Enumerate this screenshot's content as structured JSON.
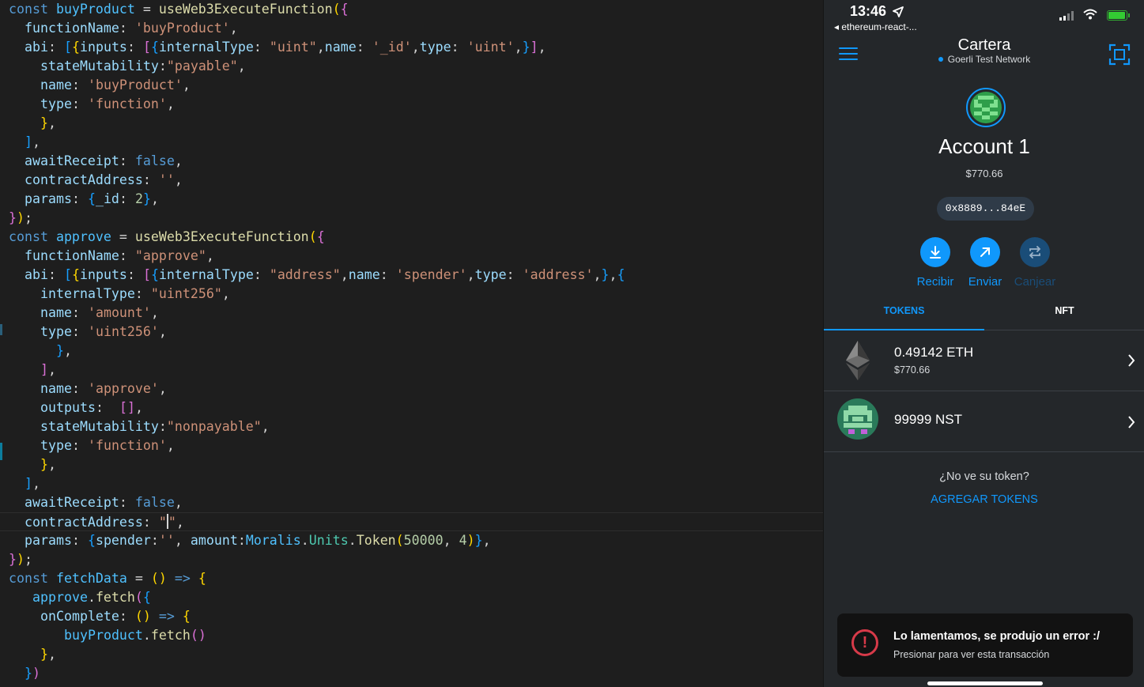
{
  "editor": {
    "lines": [
      "const buyProduct = useWeb3ExecuteFunction({",
      "  functionName: 'buyProduct',",
      "  abi: [{inputs: [{internalType: \"uint\",name: '_id',type: 'uint',}],",
      "    stateMutability:\"payable\",",
      "    name: 'buyProduct',",
      "    type: 'function',",
      "    },",
      "  ],",
      "  awaitReceipt: false,",
      "  contractAddress: '',",
      "  params: {_id: 2},",
      "});",
      "const approve = useWeb3ExecuteFunction({",
      "  functionName: \"approve\",",
      "  abi: [{inputs: [{internalType: \"address\",name: 'spender',type: 'address',},{",
      "    internalType: \"uint256\",",
      "    name: 'amount',",
      "    type: 'uint256',",
      "      },",
      "    ],",
      "    name: 'approve',",
      "    outputs:  [],",
      "    stateMutability:\"nonpayable\",",
      "    type: 'function',",
      "    },",
      "  ],",
      "  awaitReceipt: false,",
      "  contractAddress: \"\",",
      "  params: {spender:'', amount:Moralis.Units.Token(50000, 4)},",
      "});",
      "const fetchData = () => {",
      "   approve.fetch({",
      "    onComplete: () => {",
      "       buyProduct.fetch()",
      "    },",
      "  })"
    ]
  },
  "phone": {
    "status": {
      "time": "13:46",
      "back_app": "◂ ethereum-react-..."
    },
    "nav": {
      "title": "Cartera",
      "network": "Goerli Test Network",
      "menu_icon": "hamburger-menu-icon",
      "scan_icon": "qr-scan-icon"
    },
    "account": {
      "name": "Account 1",
      "balance": "$770.66",
      "address": "0x8889...84eE"
    },
    "actions": [
      {
        "label": "Recibir",
        "icon": "receive-icon",
        "enabled": true
      },
      {
        "label": "Enviar",
        "icon": "send-icon",
        "enabled": true
      },
      {
        "label": "Canjear",
        "icon": "swap-icon",
        "enabled": false
      }
    ],
    "tabs": [
      {
        "label": "TOKENS",
        "active": true
      },
      {
        "label": "NFT",
        "active": false
      }
    ],
    "tokens": [
      {
        "amount": "0.49142 ETH",
        "fiat": "$770.66",
        "icon": "ethereum-icon"
      },
      {
        "amount": "99999 NST",
        "fiat": "",
        "icon": "nst-token-icon"
      }
    ],
    "no_token_text": "¿No ve su token?",
    "add_tokens_label": "AGREGAR TOKENS",
    "toast": {
      "title": "Lo lamentamos, se produjo un error :/",
      "subtitle": "Presionar para ver esta transacción"
    },
    "colors": {
      "accent": "#1098fc",
      "error": "#d73a49",
      "background": "#24272a"
    }
  }
}
